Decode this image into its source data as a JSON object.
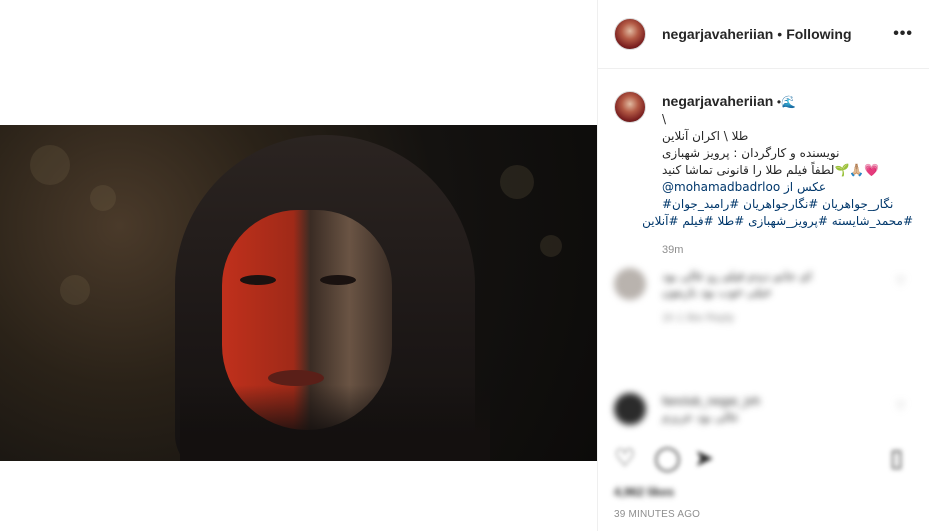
{
  "post": {
    "username": "negarjavaheriian",
    "follow_state": "Following",
    "separator": "•",
    "more_label": "•••"
  },
  "caption": {
    "username": "negarjavaheriian",
    "badge": "•🌊",
    "lines": [
      "\\",
      "طلا \\ اکران آنلاین",
      "نویسنده و کارگردان : پرویز شهبازی",
      "💗🙏🏼🌱لطفاً فیلم طلا را قانونی تماشا کنید",
      "@mohamadbadrloo عکس از",
      "نگار_جواهریان #نگارجواهریان #رامبد_جوان#",
      "#محمد_شایسته #پرویز_شهبازی #طلا #فیلم #آنلاین"
    ],
    "timestamp": "39m"
  },
  "comments": [
    {
      "text_1": "ای جانم دیدم فیلم رو عالی بود",
      "text_2": "خیلی خوب بود بازیتون",
      "meta": "1h   1 like   Reply"
    },
    {
      "text_1": "fanclub_negar_jvh",
      "text_2": "عالی بود عزیزم",
      "meta": ""
    }
  ],
  "actions": {
    "like_icon": "heart-icon",
    "comment_icon": "comment-icon",
    "share_icon": "share-icon",
    "save_icon": "bookmark-icon"
  },
  "likes_text": "4,962 likes",
  "time_ago": "39 MINUTES AGO"
}
